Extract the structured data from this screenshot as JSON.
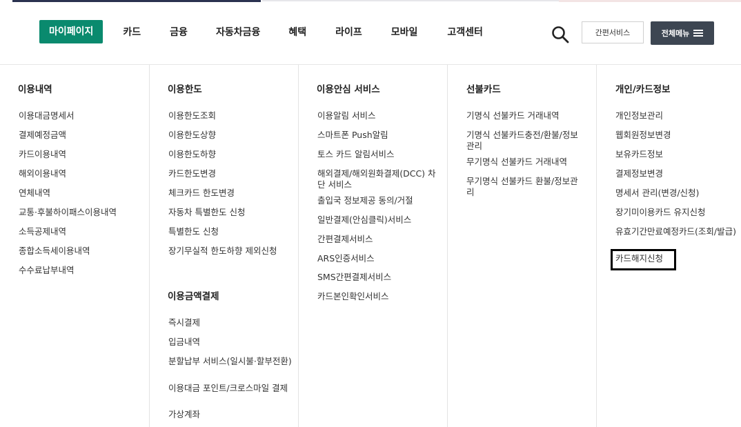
{
  "nav": {
    "items": [
      "마이페이지",
      "카드",
      "금융",
      "자동차금융",
      "혜택",
      "라이프",
      "모바일",
      "고객센터"
    ],
    "simple_service": "간편서비스",
    "all_menu": "전체메뉴"
  },
  "menu": {
    "usage": {
      "title": "이용내역",
      "items": [
        "이용대금명세서",
        "결제예정금액",
        "카드이용내역",
        "해외이용내역",
        "연체내역",
        "교통·후불하이패스이용내역",
        "소득공제내역",
        "종합소득세이용내역",
        "수수료납부내역"
      ]
    },
    "limit": {
      "title": "이용한도",
      "items": [
        "이용한도조회",
        "이용한도상향",
        "이용한도하향",
        "카드한도변경",
        "체크카드 한도변경",
        "자동차 특별한도 신청",
        "특별한도 신청",
        "장기무실적 한도하향 제외신청"
      ]
    },
    "payment": {
      "title": "이용금액결제",
      "items": [
        "즉시결제",
        "입금내역",
        "분할납부 서비스(일시불·할부전환)",
        "이용대금 포인트/크로스마일 결제",
        "가상계좌"
      ]
    },
    "safety": {
      "title": "이용안심 서비스",
      "items": [
        "이용알림 서비스",
        "스마트폰 Push알림",
        "토스 카드 알림서비스",
        "해외결제/해외원화결제(DCC) 차단 서비스",
        "출입국 정보제공 동의/거절",
        "일반결제(안심클릭)서비스",
        "간편결제서비스",
        "ARS인증서비스",
        "SMS간편결제서비스",
        "카드본인확인서비스"
      ]
    },
    "prepaid": {
      "title": "선불카드",
      "items": [
        "기명식 선불카드 거래내역",
        "기명식 선불카드충전/환불/정보관리",
        "무기명식 선불카드 거래내역",
        "무기명식 선불카드 환불/정보관리"
      ]
    },
    "personal": {
      "title": "개인/카드정보",
      "items": [
        "개인정보관리",
        "웹회원정보변경",
        "보유카드정보",
        "결제정보변경",
        "명세서 관리(변경/신청)",
        "장기미이용카드 유지신청",
        "유효기간만료예정카드(조회/발급)",
        "카드해지신청"
      ]
    }
  }
}
